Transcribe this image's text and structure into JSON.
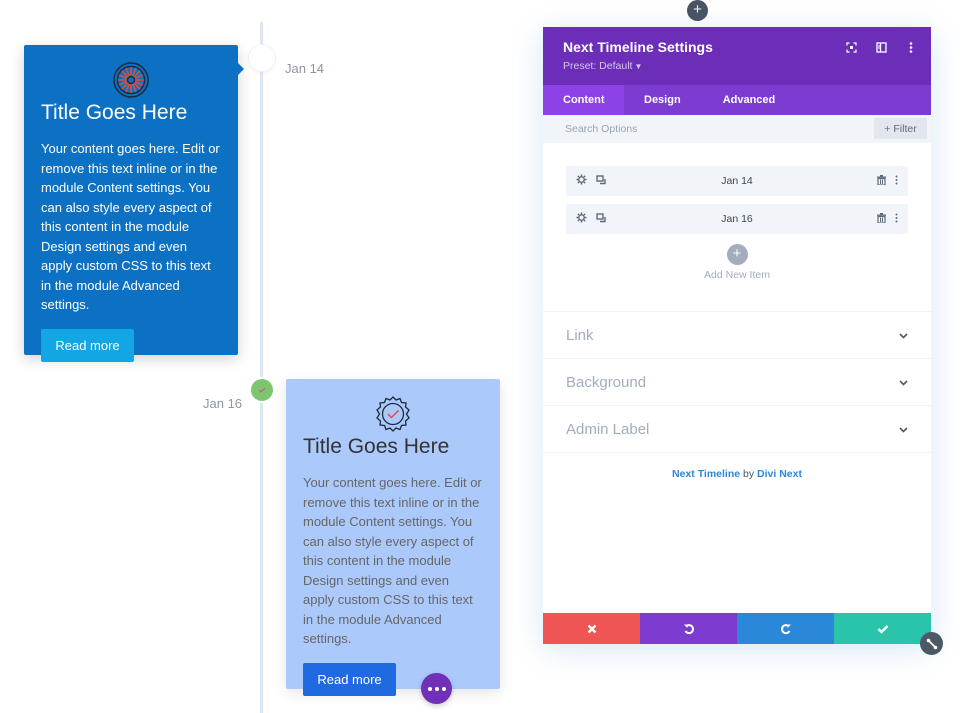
{
  "colors": {
    "card1_bg": "#0c71c3",
    "card1_button": "#12a6e5",
    "card2_bg": "#acc9fb",
    "card2_button": "#1f6ae0",
    "panel_header": "#6c2eb9",
    "tab_bar": "#7c3bd1",
    "tab_active": "#8c42e6",
    "cancel": "#ef5555",
    "undo": "#7e3bd0",
    "redo": "#2b87da",
    "save": "#29c4a9",
    "node_green": "#7dc66f"
  },
  "timeline": {
    "items": [
      {
        "date": "Jan 14",
        "icon": "wheel-icon",
        "title": "Title Goes Here",
        "body": "Your content goes here. Edit or remove this text inline or in the module Content settings. You can also style every aspect of this content in the module Design settings and even apply custom CSS to this text in the module Advanced settings.",
        "button": "Read more"
      },
      {
        "date": "Jan 16",
        "icon": "badge-check-icon",
        "title": "Title Goes Here",
        "body": "Your content goes here. Edit or remove this text inline or in the module Content settings. You can also style every aspect of this content in the module Design settings and even apply custom CSS to this text in the module Advanced settings.",
        "button": "Read more"
      }
    ]
  },
  "panel": {
    "title": "Next Timeline Settings",
    "preset": "Preset: Default",
    "tabs": [
      {
        "label": "Content",
        "active": true
      },
      {
        "label": "Design",
        "active": false
      },
      {
        "label": "Advanced",
        "active": false
      }
    ],
    "search_placeholder": "Search Options",
    "filter_label": "Filter",
    "items": [
      {
        "label": "Jan 14"
      },
      {
        "label": "Jan 16"
      }
    ],
    "add_item_label": "Add New Item",
    "sections": [
      {
        "label": "Link"
      },
      {
        "label": "Background"
      },
      {
        "label": "Admin Label"
      }
    ],
    "credit": {
      "product": "Next Timeline",
      "by": " by ",
      "vendor": "Divi Next"
    }
  }
}
